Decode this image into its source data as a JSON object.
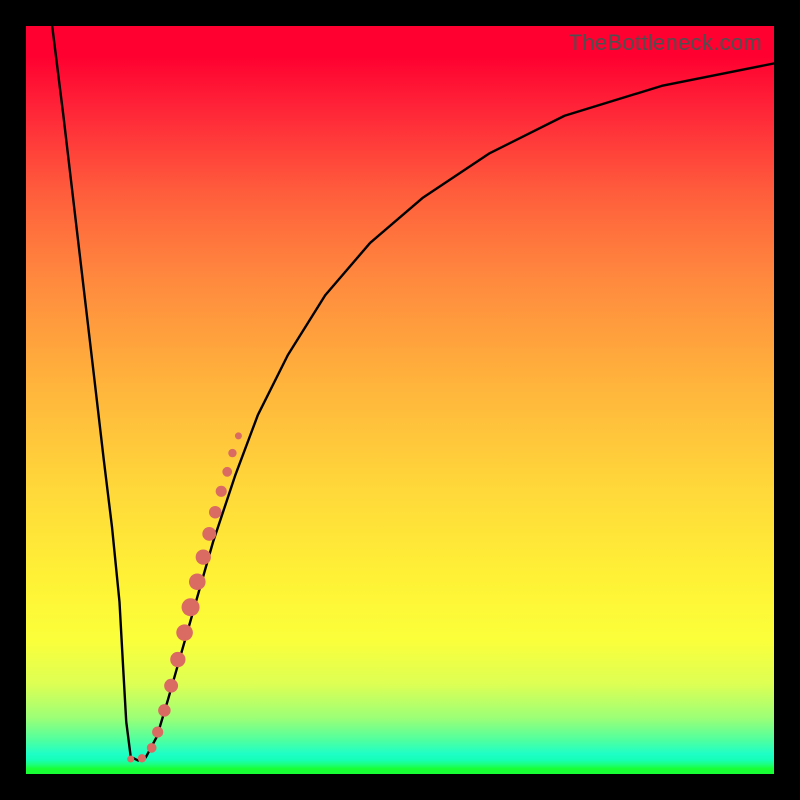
{
  "watermark": "TheBottleneck.com",
  "chart_data": {
    "type": "line",
    "title": "",
    "xlabel": "",
    "ylabel": "",
    "xlim": [
      0,
      100
    ],
    "ylim": [
      0,
      100
    ],
    "series": [
      {
        "name": "curve",
        "x": [
          3.5,
          5,
          7,
          9,
          10.4,
          11.5,
          12.5,
          13,
          13.4,
          14,
          15,
          16,
          17.5,
          19,
          21,
          23,
          25,
          28,
          31,
          35,
          40,
          46,
          53,
          62,
          72,
          85,
          100
        ],
        "y": [
          100,
          88,
          71,
          54,
          42,
          33,
          23,
          14,
          7,
          2.3,
          1.8,
          2.2,
          5,
          10,
          17,
          24,
          31,
          40,
          48,
          56,
          64,
          71,
          77,
          83,
          88,
          92,
          95
        ]
      },
      {
        "name": "markers",
        "x": [
          14.0,
          15.5,
          16.8,
          17.6,
          18.5,
          19.4,
          20.3,
          21.2,
          22.0,
          22.9,
          23.7,
          24.5,
          25.3,
          26.1,
          26.9,
          27.6,
          28.4
        ],
        "y": [
          2.0,
          2.1,
          3.5,
          5.6,
          8.5,
          11.8,
          15.3,
          18.9,
          22.3,
          25.7,
          29.0,
          32.1,
          35.0,
          37.8,
          40.4,
          42.9,
          45.2
        ]
      }
    ],
    "gradient_stops": [
      {
        "pos": 0.0,
        "color": "#ff0030"
      },
      {
        "pos": 0.04,
        "color": "#ff0030"
      },
      {
        "pos": 0.11,
        "color": "#ff2438"
      },
      {
        "pos": 0.22,
        "color": "#ff5c3c"
      },
      {
        "pos": 0.34,
        "color": "#ff8a3e"
      },
      {
        "pos": 0.48,
        "color": "#ffb43c"
      },
      {
        "pos": 0.62,
        "color": "#ffd83a"
      },
      {
        "pos": 0.74,
        "color": "#fff236"
      },
      {
        "pos": 0.82,
        "color": "#fbff3a"
      },
      {
        "pos": 0.88,
        "color": "#ddff54"
      },
      {
        "pos": 0.925,
        "color": "#9cff76"
      },
      {
        "pos": 0.955,
        "color": "#4effa0"
      },
      {
        "pos": 0.973,
        "color": "#1effc6"
      },
      {
        "pos": 0.981,
        "color": "#16ffb8"
      },
      {
        "pos": 0.987,
        "color": "#1cff80"
      },
      {
        "pos": 0.993,
        "color": "#19ff35"
      },
      {
        "pos": 1.0,
        "color": "#19ff35"
      }
    ],
    "marker_color": "#d96b62",
    "curve_color": "#000000"
  }
}
